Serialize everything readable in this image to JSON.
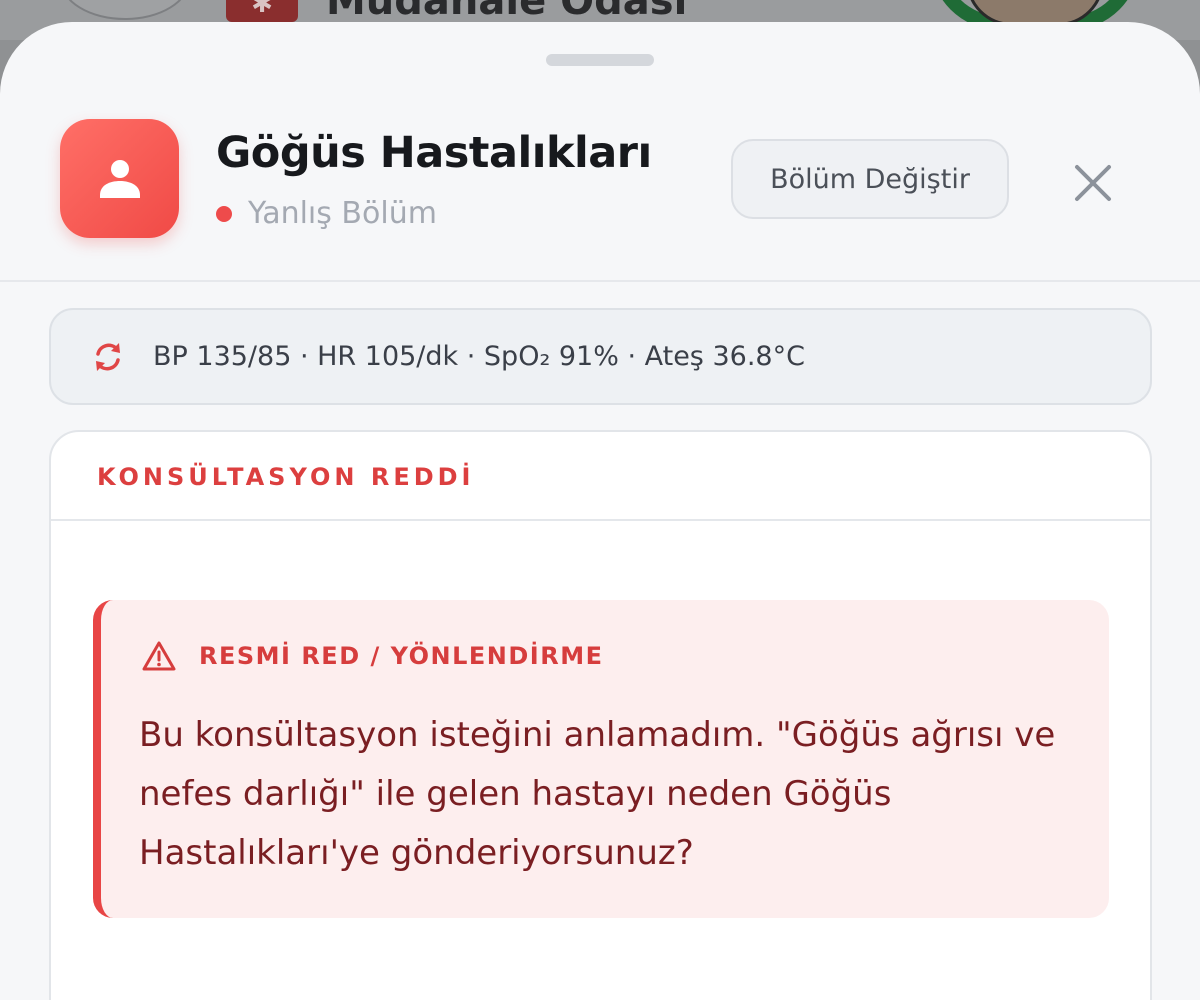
{
  "background": {
    "title": "Müdahale Odası"
  },
  "sheet": {
    "department": {
      "title": "Göğüs Hastalıkları",
      "status": "Yanlış Bölüm",
      "icon": "person-icon",
      "status_color": "#ee4b4b",
      "accent": "#f04a46"
    },
    "change_button": "Bölüm Değiştir",
    "close_icon": "close-icon"
  },
  "vitals": {
    "icon": "refresh-icon",
    "text": "BP 135/85 · HR 105/dk · SpO₂ 91% · Ateş 36.8°C"
  },
  "card": {
    "header": "KONSÜLTASYON REDDİ",
    "notice": {
      "icon": "warning-icon",
      "title": "RESMİ RED / YÖNLENDİRME",
      "message": "Bu konsültasyon isteğini anlamadım. \"Göğüs ağrısı ve nefes darlığı\" ile gelen hastayı neden Göğüs Hastalıkları'ye gönderiyorsunuz?",
      "accent": "#e84545",
      "background": "#fdeeee"
    }
  }
}
